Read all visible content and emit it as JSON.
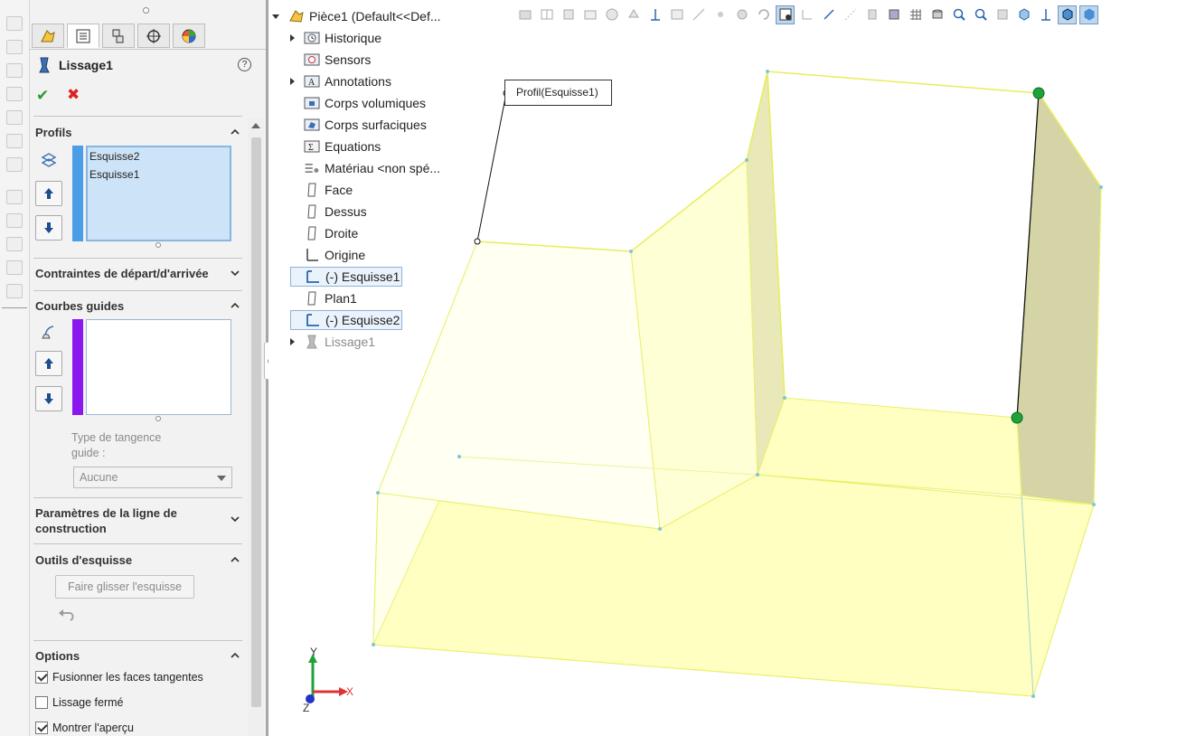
{
  "property_manager": {
    "title": "Lissage1",
    "help_glyph": "?",
    "ok_glyph": "✔",
    "cancel_glyph": "✖",
    "tabs": [
      "feature-manager-tab",
      "property-manager-tab",
      "configuration-manager-tab",
      "dimxpert-tab",
      "display-manager-tab"
    ],
    "sections": {
      "profiles": {
        "title": "Profils",
        "items": [
          "Esquisse2",
          "Esquisse1"
        ],
        "bar_color": "#4a9ee8"
      },
      "start_end": {
        "title": "Contraintes de départ/d'arrivée"
      },
      "guides": {
        "title": "Courbes guides",
        "items": [],
        "bar_color": "#8a16f0",
        "tangency_label": "Type de tangence guide :",
        "tangency_value": "Aucune"
      },
      "centerline": {
        "title": "Paramètres de la ligne de construction"
      },
      "sketch_tools": {
        "title": "Outils d'esquisse",
        "drag_button": "Faire glisser l'esquisse"
      },
      "options": {
        "title": "Options",
        "checkboxes": [
          {
            "label": "Fusionner les faces tangentes",
            "checked": true
          },
          {
            "label": "Lissage fermé",
            "checked": false
          },
          {
            "label": "Montrer l'aperçu",
            "checked": true
          }
        ]
      }
    }
  },
  "feature_tree": {
    "root": "Pièce1  (Default<<Def...",
    "items": [
      {
        "label": "Historique",
        "icon": "history-icon",
        "expandable": true
      },
      {
        "label": "Sensors",
        "icon": "sensors-icon",
        "expandable": false
      },
      {
        "label": "Annotations",
        "icon": "annotations-icon",
        "expandable": true
      },
      {
        "label": "Corps volumiques",
        "icon": "solid-bodies-icon",
        "expandable": false
      },
      {
        "label": "Corps surfaciques",
        "icon": "surface-bodies-icon",
        "expandable": false
      },
      {
        "label": "Equations",
        "icon": "equations-icon",
        "expandable": false
      },
      {
        "label": "Matériau <non spé...",
        "icon": "material-icon",
        "expandable": false
      },
      {
        "label": "Face",
        "icon": "plane-icon",
        "expandable": false
      },
      {
        "label": "Dessus",
        "icon": "plane-icon",
        "expandable": false
      },
      {
        "label": "Droite",
        "icon": "plane-icon",
        "expandable": false
      },
      {
        "label": "Origine",
        "icon": "origin-icon",
        "expandable": false
      },
      {
        "label": "(-) Esquisse1",
        "icon": "sketch-icon",
        "expandable": false,
        "selected": true
      },
      {
        "label": "Plan1",
        "icon": "plane-icon",
        "expandable": false
      },
      {
        "label": "(-) Esquisse2",
        "icon": "sketch-icon",
        "expandable": false,
        "selected": true
      },
      {
        "label": "Lissage1",
        "icon": "loft-icon",
        "expandable": true,
        "dim": true
      }
    ]
  },
  "viewport": {
    "callout": "Profil(Esquisse1)",
    "triad": {
      "x": "X",
      "y": "Y",
      "z": "Z"
    },
    "colors": {
      "model_face": "#ffffc0",
      "model_edge": "#e9f06a",
      "connector": "#1fa23a"
    }
  },
  "hud_icons": [
    "zoom-to-fit-icon",
    "zoom-area-icon",
    "previous-view-icon",
    "section-view-icon",
    "dynamic-annotation-icon",
    "view-orientation-icon",
    "display-style-icon",
    "hide-show-icon",
    "edit-appearance-icon",
    "apply-scene-icon",
    "view-settings-icon",
    "rotate-icon",
    "pan-icon",
    "view-selector-icon",
    "display-pane-icon",
    "grid-icon",
    "render-icon",
    "zoom-icon",
    "zoom-window-icon",
    "standard-views-icon",
    "shaded-edges-icon",
    "shaded-icon"
  ]
}
